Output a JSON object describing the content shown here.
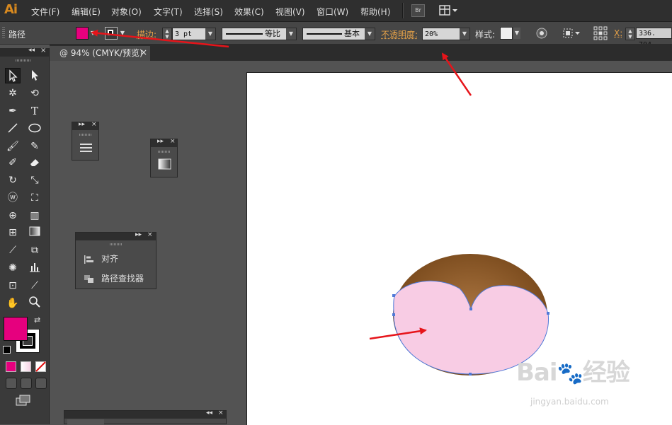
{
  "app": {
    "logo": "Ai"
  },
  "menu": {
    "items": [
      "文件(F)",
      "编辑(E)",
      "对象(O)",
      "文字(T)",
      "选择(S)",
      "效果(C)",
      "视图(V)",
      "窗口(W)",
      "帮助(H)"
    ],
    "bridge_label": "Br"
  },
  "control_bar": {
    "object_type": "路径",
    "fill_color": "#e6007e",
    "stroke_label": "描边:",
    "stroke_weight": "3 pt",
    "stroke_profile": "等比",
    "brush": "基本",
    "opacity_label": "不透明度:",
    "opacity_value": "20%",
    "style_label": "样式:",
    "x_label": "X:",
    "x_value": "336. 704"
  },
  "document": {
    "tab_title": "@ 94% (CMYK/预览)",
    "close_glyph": "×"
  },
  "panels": {
    "align_panel": {
      "items": [
        "对齐",
        "路径查找器"
      ]
    }
  },
  "colors": {
    "fill": "#e6007e",
    "stroke": "#000000",
    "shape_pink": "#f8cce4",
    "shape_brown_dark": "#6d3f13",
    "shape_brown_light": "#a8733f",
    "selection_blue": "#4f79d8",
    "annotation_red": "#e6141a"
  },
  "watermark": {
    "brand": "Bai",
    "brand_suffix": "经验",
    "url": "jingyan.baidu.com"
  }
}
